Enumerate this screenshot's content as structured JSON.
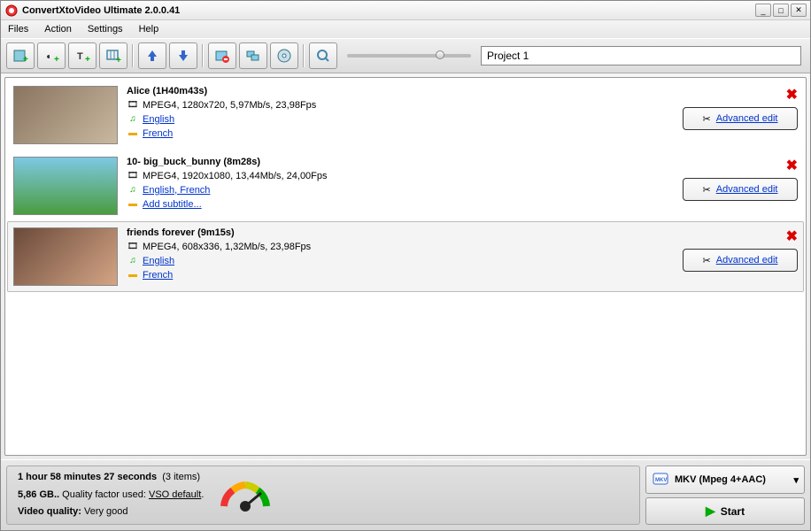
{
  "window": {
    "title": "ConvertXtoVideo Ultimate 2.0.0.41"
  },
  "menu": {
    "files": "Files",
    "action": "Action",
    "settings": "Settings",
    "help": "Help"
  },
  "toolbar": {
    "project_name": "Project 1"
  },
  "items": [
    {
      "title": "Alice (1H40m43s)",
      "format": "MPEG4, 1280x720, 5,97Mb/s, 23,98Fps",
      "audio": "English",
      "subtitle": "French",
      "advanced": "Advanced edit",
      "selected": false
    },
    {
      "title": "10- big_buck_bunny (8m28s)",
      "format": "MPEG4, 1920x1080, 13,44Mb/s, 24,00Fps",
      "audio": "English, French",
      "subtitle": "Add subtitle...",
      "advanced": "Advanced edit",
      "selected": false
    },
    {
      "title": "friends forever (9m15s)",
      "format": "MPEG4, 608x336, 1,32Mb/s, 23,98Fps",
      "audio": "English",
      "subtitle": "French",
      "advanced": "Advanced edit",
      "selected": true
    }
  ],
  "status": {
    "duration": "1 hour 58 minutes 27 seconds",
    "count": "(3 items)",
    "size": "5,86 GB..",
    "quality_factor_label": "Quality factor used:",
    "quality_factor": "VSO default",
    "video_quality_label": "Video quality:",
    "video_quality": "Very good"
  },
  "output": {
    "format": "MKV (Mpeg 4+AAC)",
    "start": "Start"
  }
}
